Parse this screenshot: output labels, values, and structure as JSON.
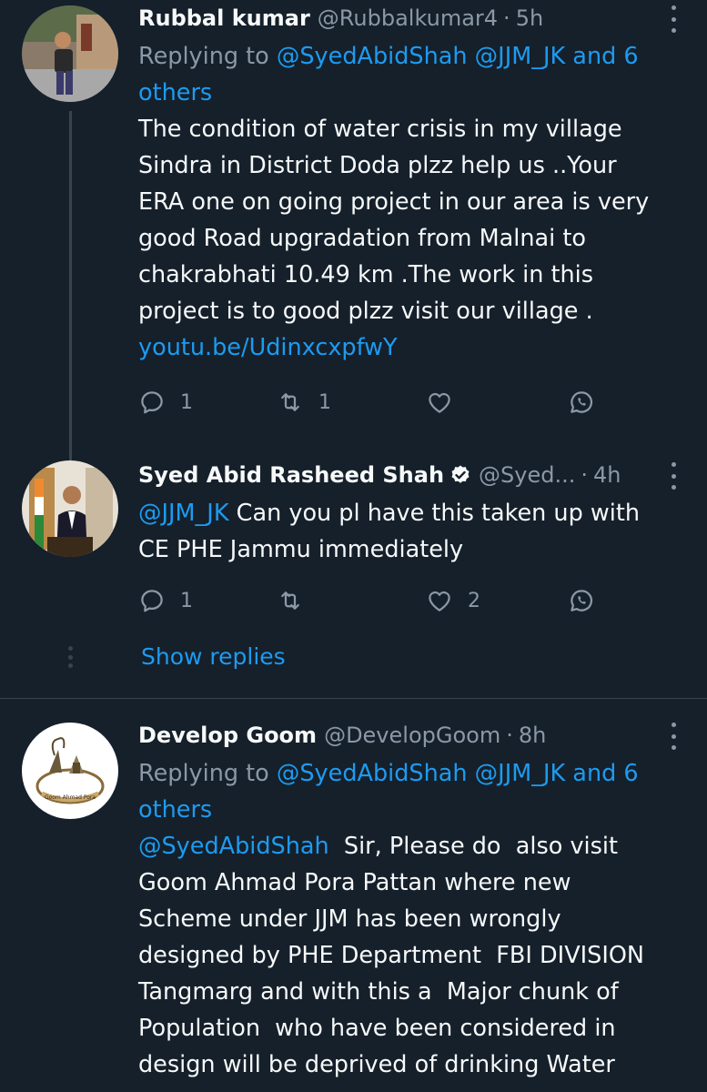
{
  "tweets": [
    {
      "name": "Rubbal kumar",
      "handle": "@Rubbalkumar4",
      "time": "5h",
      "reply_prefix": "Replying to",
      "reply_to": "@SyedAbidShah @JJM_JK and 6",
      "reply_to_cont": "others",
      "lines": [
        "The condition of water crisis in my village",
        "Sindra in District Doda plzz help us ..Your",
        "ERA one on going project in our area is very",
        "good Road upgradation from Malnai to",
        "chakrabhati 10.49 km .The work in this",
        "project is to good plzz visit our village ."
      ],
      "link": "youtu.be/UdinxcxpfwY",
      "reply_count": "1",
      "retweet_count": "1",
      "like_count": ""
    },
    {
      "name": "Syed Abid Rasheed Shah",
      "handle": "@Syed...",
      "time": "4h",
      "mention": "@JJM_JK",
      "line1_rest": " Can you pl have this taken up with",
      "line2": "CE PHE Jammu immediately",
      "reply_count": "1",
      "retweet_count": "",
      "like_count": "2",
      "show_replies": "Show replies"
    },
    {
      "name": "Develop Goom",
      "handle": "@DevelopGoom",
      "time": "8h",
      "reply_prefix": "Replying to",
      "reply_to": "@SyedAbidShah @JJM_JK and 6",
      "reply_to_cont": "others",
      "mention": "@SyedAbidShah",
      "line1_rest": "  Sir, Please do  also visit",
      "lines": [
        "Goom Ahmad Pora Pattan where new",
        "Scheme under JJM has been wrongly",
        "designed by PHE Department  FBI DIVISION",
        "Tangmarg and with this a  Major chunk of",
        "Population  who have been considered in",
        "design will be deprived of drinking Water"
      ],
      "avatar_label": "Goom Ahmad Pora"
    }
  ],
  "separator": "·",
  "colors": {
    "background": "#15202b",
    "text": "#f7f9f9",
    "muted": "#8b98a5",
    "link": "#1d9bf0",
    "divider": "#38444d"
  }
}
